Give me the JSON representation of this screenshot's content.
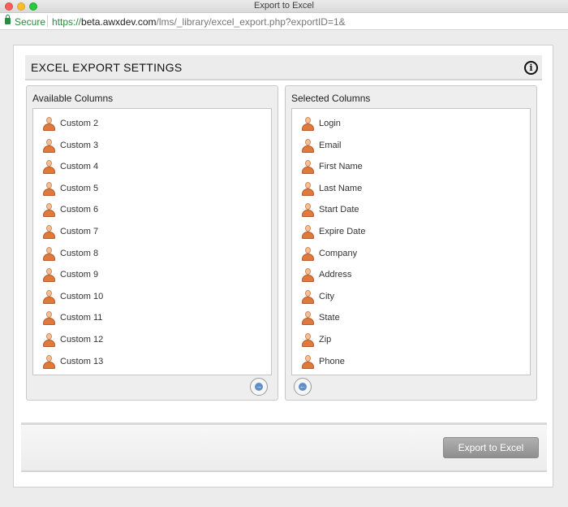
{
  "window": {
    "title": "Export to Excel"
  },
  "urlbar": {
    "secure_label": "Secure",
    "scheme": "https://",
    "host": "beta.awxdev.com",
    "path": "/lms/_library/excel_export.php?exportID=1&"
  },
  "panel": {
    "title": "EXCEL EXPORT SETTINGS",
    "info_glyph": "i"
  },
  "available": {
    "title": "Available Columns",
    "items": [
      "Custom 2",
      "Custom 3",
      "Custom 4",
      "Custom 5",
      "Custom 6",
      "Custom 7",
      "Custom 8",
      "Custom 9",
      "Custom 10",
      "Custom 11",
      "Custom 12",
      "Custom 13"
    ]
  },
  "selected": {
    "title": "Selected Columns",
    "items": [
      "Login",
      "Email",
      "First Name",
      "Last Name",
      "Start Date",
      "Expire Date",
      "Company",
      "Address",
      "City",
      "State",
      "Zip",
      "Phone"
    ]
  },
  "buttons": {
    "export_label": "Export to Excel",
    "move_right_glyph": "→",
    "move_left_glyph": "←"
  },
  "icons": {
    "list_item": "person-icon",
    "lock": "lock-icon",
    "info": "info-icon"
  }
}
